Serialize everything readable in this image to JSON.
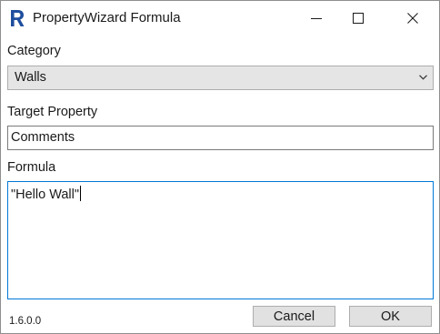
{
  "window": {
    "title": "PropertyWizard Formula",
    "app_icon": "revit-r-icon",
    "controls": [
      "minimize-icon",
      "maximize-icon",
      "close-icon"
    ]
  },
  "category": {
    "label": "Category",
    "selected": "Walls"
  },
  "target_property": {
    "label": "Target Property",
    "value": "Comments"
  },
  "formula": {
    "label": "Formula",
    "value": "\"Hello Wall\""
  },
  "footer": {
    "version": "1.6.0.0",
    "cancel_label": "Cancel",
    "ok_label": "OK"
  },
  "colors": {
    "accent": "#0078d7",
    "app_icon": "#1f4e9e",
    "button_bg": "#e1e1e1",
    "select_bg": "#e5e5e5"
  }
}
